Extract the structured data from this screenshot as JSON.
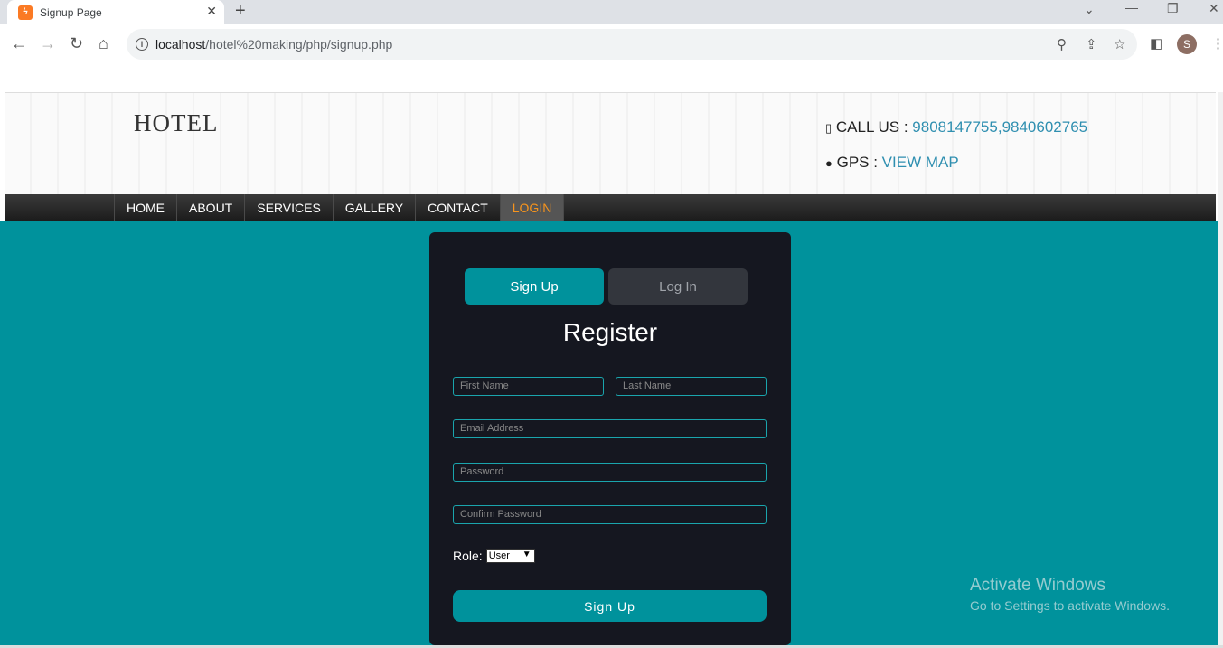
{
  "browser": {
    "tab_title": "Signup Page",
    "url_host": "localhost",
    "url_path": "/hotel%20making/php/signup.php",
    "avatar_letter": "S"
  },
  "header": {
    "logo": "HOTEL",
    "call_label": "CALL US : ",
    "phone": "9808147755,9840602765",
    "gps_label": "GPS : ",
    "map_link": "VIEW MAP"
  },
  "nav": {
    "items": [
      "HOME",
      "ABOUT",
      "SERVICES",
      "GALLERY",
      "CONTACT",
      "LOGIN"
    ],
    "active": "LOGIN"
  },
  "form": {
    "tab_signup": "Sign Up",
    "tab_login": "Log In",
    "heading": "Register",
    "first_name_placeholder": "First Name",
    "last_name_placeholder": "Last Name",
    "email_placeholder": "Email Address",
    "password_placeholder": "Password",
    "confirm_placeholder": "Confirm Password",
    "role_label": "Role:",
    "role_value": "User",
    "submit_label": "Sign Up"
  },
  "watermark": {
    "title": "Activate Windows",
    "subtitle": "Go to Settings to activate Windows."
  },
  "colors": {
    "accent": "#00929c",
    "card": "#151720",
    "nav_active": "#f7941d",
    "link": "#2f8fb0"
  }
}
